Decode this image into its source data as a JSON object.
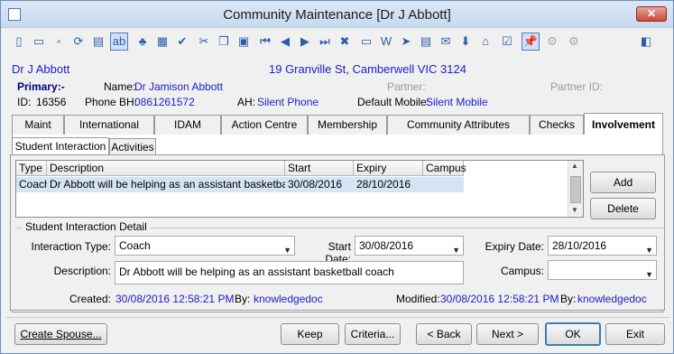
{
  "window": {
    "title": "Community Maintenance  [Dr J Abbott]",
    "close_label": "✕"
  },
  "toolbar": {
    "icons": [
      {
        "name": "new-icon",
        "glyph": "▯"
      },
      {
        "name": "open-folder-icon",
        "glyph": "▭"
      },
      {
        "name": "save-icon",
        "glyph": "▪"
      },
      {
        "name": "refresh-icon",
        "glyph": "⟳"
      },
      {
        "name": "print-icon",
        "glyph": "▤"
      },
      {
        "name": "text-field-icon",
        "glyph": "ab"
      },
      {
        "name": "tree-icon",
        "glyph": "♣"
      },
      {
        "name": "calculator-icon",
        "glyph": "▦"
      },
      {
        "name": "spellcheck-icon",
        "glyph": "✔"
      },
      {
        "name": "cut-icon",
        "glyph": "✂"
      },
      {
        "name": "copy-icon",
        "glyph": "❐"
      },
      {
        "name": "paste-icon",
        "glyph": "▣"
      },
      {
        "name": "first-record-icon",
        "glyph": "⏮"
      },
      {
        "name": "previous-record-icon",
        "glyph": "◀"
      },
      {
        "name": "next-record-icon",
        "glyph": "▶"
      },
      {
        "name": "last-record-icon",
        "glyph": "⏭"
      },
      {
        "name": "delete-icon",
        "glyph": "✖"
      },
      {
        "name": "card-icon",
        "glyph": "▭"
      },
      {
        "name": "word-icon",
        "glyph": "W"
      },
      {
        "name": "send-icon",
        "glyph": "➤"
      },
      {
        "name": "clipboard-icon",
        "glyph": "▤"
      },
      {
        "name": "mail-icon",
        "glyph": "✉"
      },
      {
        "name": "download-icon",
        "glyph": "⬇"
      },
      {
        "name": "tag-icon",
        "glyph": "⌂"
      },
      {
        "name": "checklist-icon",
        "glyph": "☑"
      },
      {
        "name": "pin-icon",
        "glyph": "📌"
      },
      {
        "name": "gears-icon",
        "glyph": "⚙"
      },
      {
        "name": "gears-alt-icon",
        "glyph": "⚙"
      },
      {
        "name": "exit-panel-icon",
        "glyph": "◧"
      }
    ]
  },
  "header": {
    "name": "Dr J Abbott",
    "address": "19 Granville St, Camberwell VIC 3124",
    "primary_label": "Primary:-",
    "partner_label": "Partner:",
    "partner_id_label": "Partner ID:",
    "id_label": "ID:",
    "id_value": "16356",
    "fullname_label": "Name:",
    "fullname_value": "Dr Jamison Abbott",
    "phone_bh_label": "Phone BH:",
    "phone_bh_value": "0861261572",
    "ah_label": "AH:",
    "ah_value": "Silent Phone",
    "mobile_label": "Default Mobile:",
    "mobile_value": "Silent Mobile"
  },
  "tabs": [
    "Maint",
    "International",
    "IDAM",
    "Action Centre",
    "Membership",
    "Community Attributes",
    "Checks",
    "Involvement"
  ],
  "selected_tab": "Involvement",
  "subtabs": [
    "Student Interaction",
    "Activities"
  ],
  "grid": {
    "columns": [
      "Type",
      "Description",
      "Start",
      "Expiry",
      "Campus"
    ],
    "rows": [
      {
        "type": "Coach",
        "description": "Dr Abbott will be helping as an assistant basketball coach",
        "start": "30/08/2016",
        "expiry": "28/10/2016",
        "campus": ""
      }
    ]
  },
  "buttons": {
    "add": "Add",
    "delete": "Delete"
  },
  "detail": {
    "group_title": "Student Interaction Detail",
    "interaction_type_label": "Interaction Type:",
    "interaction_type_value": "Coach",
    "start_date_label": "Start Date:",
    "start_date_value": "30/08/2016",
    "expiry_date_label": "Expiry Date:",
    "expiry_date_value": "28/10/2016",
    "description_label": "Description:",
    "description_value": "Dr Abbott will be helping as an assistant basketball coach",
    "campus_label": "Campus:",
    "campus_value": "",
    "created_label": "Created:",
    "created_value": "30/08/2016 12:58:21 PM",
    "created_by_label": "By:",
    "created_by_value": "knowledgedoc",
    "modified_label": "Modified:",
    "modified_value": "30/08/2016 12:58:21 PM",
    "modified_by_label": "By:",
    "modified_by_value": "knowledgedoc"
  },
  "footer": {
    "create_spouse": "Create Spouse...",
    "keep": "Keep",
    "criteria": "Criteria...",
    "back": "< Back",
    "next": "Next >",
    "ok": "OK",
    "exit": "Exit"
  }
}
